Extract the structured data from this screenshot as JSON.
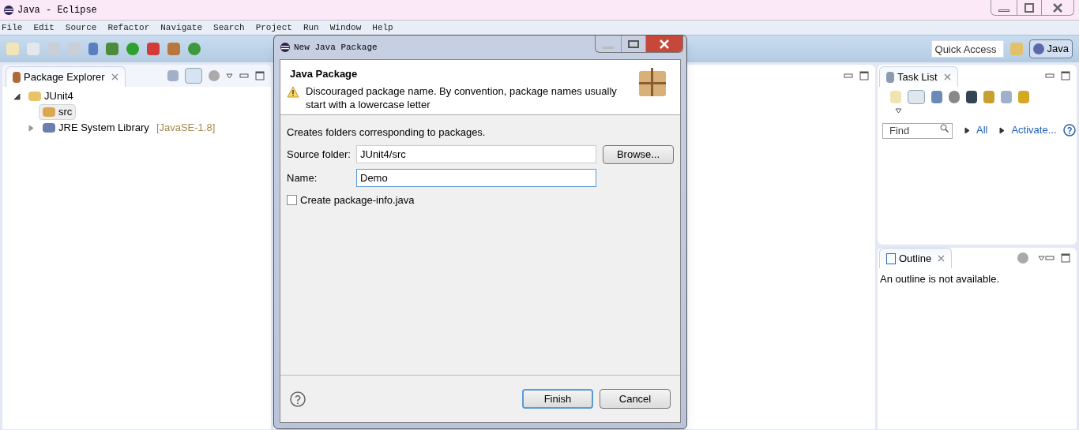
{
  "window": {
    "title": "Java - Eclipse"
  },
  "menu": [
    "File",
    "Edit",
    "Source",
    "Refactor",
    "Navigate",
    "Search",
    "Project",
    "Run",
    "Window",
    "Help"
  ],
  "quick_access": {
    "placeholder": "Quick Access"
  },
  "perspectives": [
    {
      "label": "Java",
      "selected": true
    }
  ],
  "package_explorer": {
    "title": "Package Explorer",
    "tree": [
      {
        "label": "JUnit4",
        "kind": "project",
        "expanded": true,
        "selected": false,
        "children": [
          {
            "label": "src",
            "kind": "source-folder",
            "selected": true
          },
          {
            "label": "JRE System Library",
            "decoration": "[JavaSE-1.8]",
            "kind": "library",
            "expanded": false,
            "selected": false
          }
        ]
      }
    ]
  },
  "task_list": {
    "title": "Task List",
    "find": {
      "placeholder": "Find"
    },
    "links": [
      "All",
      "Activate..."
    ]
  },
  "outline": {
    "title": "Outline",
    "message": "An outline is not available."
  },
  "dialog": {
    "title": "New Java Package",
    "header": "Java Package",
    "warning": "Discouraged package name. By convention, package names usually start with a lowercase letter",
    "description": "Creates folders corresponding to packages.",
    "fields": [
      {
        "label": "Source folder:",
        "value": "JUnit4/src",
        "button": "Browse...",
        "focused": false
      },
      {
        "label": "Name:",
        "value": "Demo",
        "focused": true
      }
    ],
    "checkbox": {
      "label": "Create package-info.java",
      "checked": false
    },
    "buttons": [
      {
        "label": "Finish",
        "default": true
      },
      {
        "label": "Cancel",
        "default": false
      }
    ]
  }
}
